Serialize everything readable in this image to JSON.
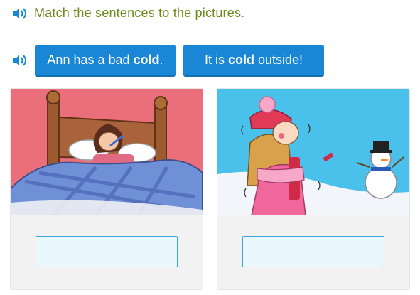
{
  "instruction": "Match the sentences to the pictures.",
  "tiles": [
    {
      "before": "Ann has a bad ",
      "bold": "cold",
      "after": "."
    },
    {
      "before": "It is ",
      "bold": "cold",
      "after": " outside!"
    }
  ],
  "pictures": [
    {
      "icon": "girl-sick-in-bed-illustration"
    },
    {
      "icon": "girl-shivering-in-snow-illustration"
    }
  ],
  "colors": {
    "instruction": "#6c8a1a",
    "tile": "#1a87d6",
    "dropzone_border": "#3aa7dc",
    "dropzone_fill": "#eaf8fd"
  }
}
